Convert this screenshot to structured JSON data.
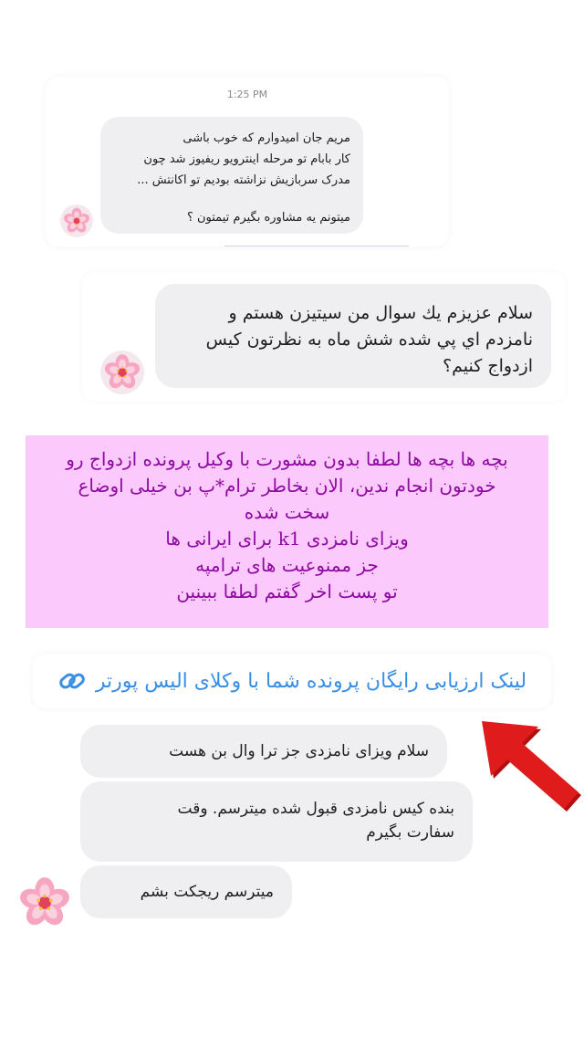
{
  "colors": {
    "bubble": "#efeff1",
    "notice_bg": "#fbc9fb",
    "notice_text": "#8f0aa2",
    "link": "#3a8fe3",
    "arrow": "#e01b1b"
  },
  "message_1": {
    "time": "1:25 PM",
    "lines": [
      "مریم جان امیدوارم که خوب باشی",
      "کار بابام تو مرحله اینترویو ریفیوز شد چون",
      "مدرک سربازیش نزاشته بودیم تو اکانتش ...",
      "",
      "میتونم یه مشاوره بگیرم تیمتون ؟"
    ],
    "avatar": "cherry-blossom-icon"
  },
  "message_2": {
    "lines": [
      "سلام عزیزم يك سوال من سیتیزن هستم و",
      "نامزدم اي پي شده شش ماه به نظرتون کیس",
      "ازدواج کنیم؟"
    ],
    "avatar": "cherry-blossom-icon"
  },
  "notice": {
    "lines": [
      "بچه ها بچه ها لطفا بدون مشورت با وکیل پرونده ازدواج رو",
      "خودتون انجام ندین، الان بخاطر ترام*پ بن خیلی اوضاع",
      "سخت شده",
      "ویزای نامزدی k1 برای ایرانی ها",
      "جز ممنوعیت های ترامپه",
      "تو پست اخر گفتم لطفا ببینین"
    ]
  },
  "link_sticker": {
    "text": "لینک ارزیابی رایگان پرونده شما با وکلای الیس پورتر",
    "icon": "link-icon"
  },
  "arrow": {
    "icon": "red-arrow-icon"
  },
  "message_3": {
    "bubbles": [
      [
        "سلام  ویزای  نامزدی جز ترا وال بن هست"
      ],
      [
        "بنده کیس نامزدی قبول شده میترسم. وقت",
        "سفارت بگیرم"
      ],
      [
        "میترسم  ریجکت بشم"
      ]
    ],
    "avatar": "cherry-blossom-icon"
  }
}
